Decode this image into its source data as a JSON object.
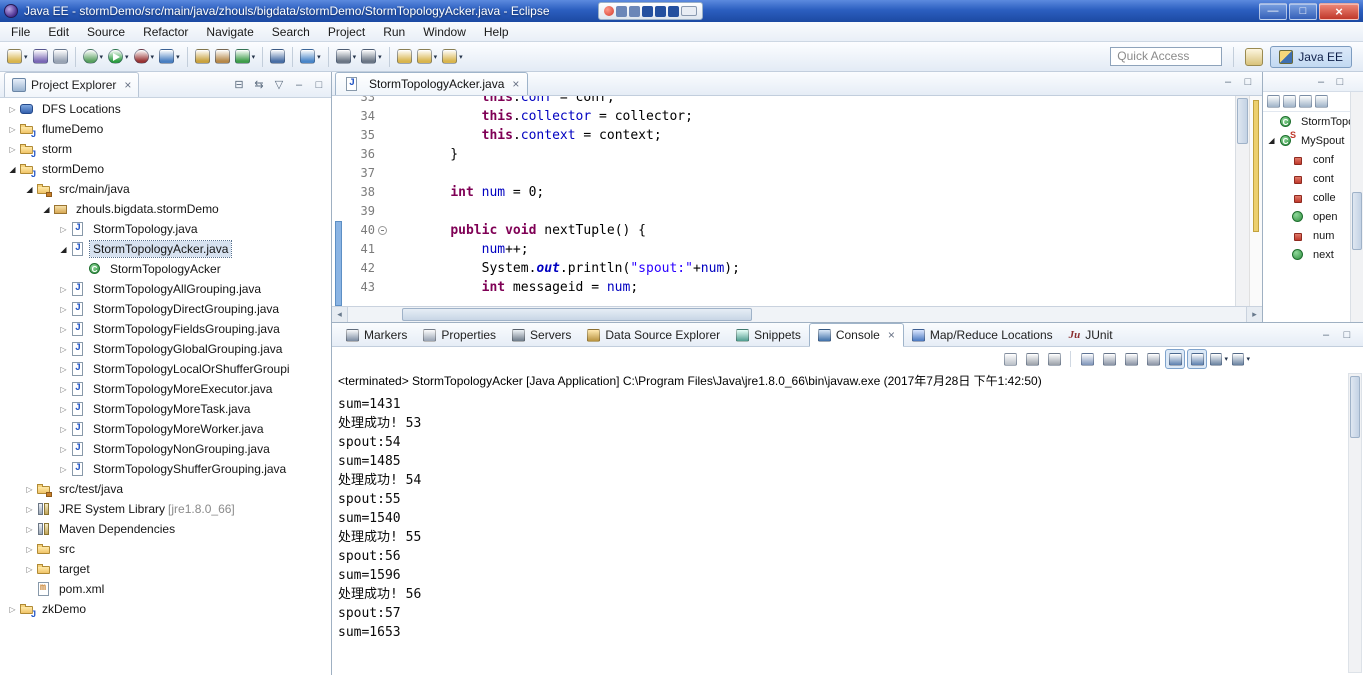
{
  "window": {
    "title": "Java EE - stormDemo/src/main/java/zhouls/bigdata/stormDemo/StormTopologyAcker.java - Eclipse"
  },
  "menubar": [
    "File",
    "Edit",
    "Source",
    "Refactor",
    "Navigate",
    "Search",
    "Project",
    "Run",
    "Window",
    "Help"
  ],
  "toolbar": {
    "quick_access": "Quick Access",
    "perspective_label": "Java EE",
    "icons": [
      {
        "name": "new",
        "color": "#d9b54e",
        "dropdown": true
      },
      {
        "name": "save",
        "color": "#7a68b5"
      },
      {
        "name": "print",
        "color": "#98a3b3"
      },
      {
        "name": "separator"
      },
      {
        "name": "debug",
        "color": "#58a05e",
        "dropdown": true
      },
      {
        "name": "run",
        "color": "#2e9e41",
        "dropdown": true
      },
      {
        "name": "coverage",
        "color": "#993333",
        "dropdown": true
      },
      {
        "name": "run-external",
        "color": "#4a7fc1",
        "dropdown": true
      },
      {
        "name": "separator"
      },
      {
        "name": "new-java-project",
        "color": "#c9a23f"
      },
      {
        "name": "new-package",
        "color": "#b5884a"
      },
      {
        "name": "new-class",
        "color": "#3f9d4b",
        "dropdown": true
      },
      {
        "name": "separator"
      },
      {
        "name": "search",
        "color": "#4a6fa5"
      },
      {
        "name": "separator"
      },
      {
        "name": "external-tools",
        "color": "#4a86c8",
        "dropdown": true
      },
      {
        "name": "separator"
      },
      {
        "name": "next-annotation",
        "color": "#6b7685",
        "dropdown": true
      },
      {
        "name": "previous-annotation",
        "color": "#6b7685",
        "dropdown": true
      },
      {
        "name": "separator"
      },
      {
        "name": "last-edit-location",
        "color": "#d9b54e"
      },
      {
        "name": "back",
        "color": "#d9b54e",
        "dropdown": true
      },
      {
        "name": "forward",
        "color": "#d9b54e",
        "dropdown": true
      }
    ]
  },
  "project_explorer": {
    "title": "Project Explorer",
    "items": [
      {
        "label": "DFS Locations",
        "depth": 0,
        "icon": "dfs",
        "arrow": "collapsed"
      },
      {
        "label": "flumeDemo",
        "depth": 0,
        "icon": "project",
        "arrow": "collapsed"
      },
      {
        "label": "storm",
        "depth": 0,
        "icon": "project",
        "arrow": "collapsed"
      },
      {
        "label": "stormDemo",
        "depth": 0,
        "icon": "project",
        "arrow": "expanded"
      },
      {
        "label": "src/main/java",
        "depth": 1,
        "icon": "srcfolder",
        "arrow": "expanded"
      },
      {
        "label": "zhouls.bigdata.stormDemo",
        "depth": 2,
        "icon": "package",
        "arrow": "expanded"
      },
      {
        "label": "StormTopology.java",
        "depth": 3,
        "icon": "jfile",
        "arrow": "collapsed"
      },
      {
        "label": "StormTopologyAcker.java",
        "depth": 3,
        "icon": "jfile",
        "arrow": "expanded",
        "selected": true
      },
      {
        "label": "StormTopologyAcker",
        "depth": 4,
        "icon": "class",
        "arrow": "none"
      },
      {
        "label": "StormTopologyAllGrouping.java",
        "depth": 3,
        "icon": "jfile",
        "arrow": "collapsed"
      },
      {
        "label": "StormTopologyDirectGrouping.java",
        "depth": 3,
        "icon": "jfile",
        "arrow": "collapsed"
      },
      {
        "label": "StormTopologyFieldsGrouping.java",
        "depth": 3,
        "icon": "jfile",
        "arrow": "collapsed"
      },
      {
        "label": "StormTopologyGlobalGrouping.java",
        "depth": 3,
        "icon": "jfile",
        "arrow": "collapsed"
      },
      {
        "label": "StormTopologyLocalOrShufferGroupi",
        "depth": 3,
        "icon": "jfile",
        "arrow": "collapsed"
      },
      {
        "label": "StormTopologyMoreExecutor.java",
        "depth": 3,
        "icon": "jfile",
        "arrow": "collapsed"
      },
      {
        "label": "StormTopologyMoreTask.java",
        "depth": 3,
        "icon": "jfile",
        "arrow": "collapsed"
      },
      {
        "label": "StormTopologyMoreWorker.java",
        "depth": 3,
        "icon": "jfile",
        "arrow": "collapsed"
      },
      {
        "label": "StormTopologyNonGrouping.java",
        "depth": 3,
        "icon": "jfile",
        "arrow": "collapsed"
      },
      {
        "label": "StormTopologyShufferGrouping.java",
        "depth": 3,
        "icon": "jfile",
        "arrow": "collapsed"
      },
      {
        "label": "src/test/java",
        "depth": 1,
        "icon": "srcfolder",
        "arrow": "collapsed"
      },
      {
        "label": "JRE System Library ",
        "suffix": "[jre1.8.0_66]",
        "depth": 1,
        "icon": "library",
        "arrow": "collapsed"
      },
      {
        "label": "Maven Dependencies",
        "depth": 1,
        "icon": "library",
        "arrow": "collapsed"
      },
      {
        "label": "src",
        "depth": 1,
        "icon": "folder",
        "arrow": "collapsed"
      },
      {
        "label": "target",
        "depth": 1,
        "icon": "folder",
        "arrow": "collapsed"
      },
      {
        "label": "pom.xml",
        "depth": 1,
        "icon": "xmlfile",
        "arrow": "none"
      },
      {
        "label": "zkDemo",
        "depth": 0,
        "icon": "project",
        "arrow": "collapsed"
      }
    ]
  },
  "editor": {
    "tab_label": "StormTopologyAcker.java",
    "lines": [
      {
        "n": 33,
        "fold": false,
        "tokens": [
          {
            "t": "        ",
            "c": "d"
          },
          {
            "t": "this",
            "c": "k"
          },
          {
            "t": ".",
            "c": "d"
          },
          {
            "t": "conf",
            "c": "f"
          },
          {
            "t": " = conf;",
            "c": "d"
          }
        ]
      },
      {
        "n": 34,
        "fold": false,
        "tokens": [
          {
            "t": "        ",
            "c": "d"
          },
          {
            "t": "this",
            "c": "k"
          },
          {
            "t": ".",
            "c": "d"
          },
          {
            "t": "collector",
            "c": "f"
          },
          {
            "t": " = collector;",
            "c": "d"
          }
        ]
      },
      {
        "n": 35,
        "fold": false,
        "tokens": [
          {
            "t": "        ",
            "c": "d"
          },
          {
            "t": "this",
            "c": "k"
          },
          {
            "t": ".",
            "c": "d"
          },
          {
            "t": "context",
            "c": "f"
          },
          {
            "t": " = context;",
            "c": "d"
          }
        ]
      },
      {
        "n": 36,
        "fold": false,
        "tokens": [
          {
            "t": "    }",
            "c": "d"
          }
        ]
      },
      {
        "n": 37,
        "fold": false,
        "tokens": []
      },
      {
        "n": 38,
        "fold": false,
        "tokens": [
          {
            "t": "    ",
            "c": "d"
          },
          {
            "t": "int",
            "c": "k"
          },
          {
            "t": " ",
            "c": "d"
          },
          {
            "t": "num",
            "c": "f"
          },
          {
            "t": " = 0;",
            "c": "d"
          }
        ]
      },
      {
        "n": 39,
        "fold": false,
        "tokens": []
      },
      {
        "n": 40,
        "fold": true,
        "tokens": [
          {
            "t": "    ",
            "c": "d"
          },
          {
            "t": "public",
            "c": "k"
          },
          {
            "t": " ",
            "c": "d"
          },
          {
            "t": "void",
            "c": "k"
          },
          {
            "t": " nextTuple() {",
            "c": "d"
          }
        ]
      },
      {
        "n": 41,
        "fold": false,
        "tokens": [
          {
            "t": "        ",
            "c": "d"
          },
          {
            "t": "num",
            "c": "f"
          },
          {
            "t": "++;",
            "c": "d"
          }
        ]
      },
      {
        "n": 42,
        "fold": false,
        "tokens": [
          {
            "t": "        System.",
            "c": "d"
          },
          {
            "t": "out",
            "c": "sf"
          },
          {
            "t": ".println(",
            "c": "d"
          },
          {
            "t": "\"spout:\"",
            "c": "s"
          },
          {
            "t": "+",
            "c": "d"
          },
          {
            "t": "num",
            "c": "f"
          },
          {
            "t": ");",
            "c": "d"
          }
        ]
      },
      {
        "n": 43,
        "fold": false,
        "tokens": [
          {
            "t": "        ",
            "c": "d"
          },
          {
            "t": "int",
            "c": "k"
          },
          {
            "t": " messageid = ",
            "c": "d"
          },
          {
            "t": "num",
            "c": "f"
          },
          {
            "t": ";",
            "c": "d"
          }
        ]
      }
    ]
  },
  "outline": {
    "items": [
      {
        "label": "StormTopolo",
        "depth": 0,
        "icon": "class",
        "arrow": "none"
      },
      {
        "label": "MySpout",
        "depth": 0,
        "icon": "class-s",
        "arrow": "expanded"
      },
      {
        "label": "conf",
        "depth": 1,
        "icon": "field",
        "arrow": "none"
      },
      {
        "label": "cont",
        "depth": 1,
        "icon": "field",
        "arrow": "none"
      },
      {
        "label": "colle",
        "depth": 1,
        "icon": "field",
        "arrow": "none"
      },
      {
        "label": "open",
        "depth": 1,
        "icon": "method",
        "arrow": "none"
      },
      {
        "label": "num",
        "depth": 1,
        "icon": "field",
        "ar row": "none",
        "arrow": "none"
      },
      {
        "label": "next",
        "depth": 1,
        "icon": "method",
        "arrow": "none"
      }
    ]
  },
  "console": {
    "tabs": [
      {
        "label": "Markers",
        "icon": "markers"
      },
      {
        "label": "Properties",
        "icon": "properties"
      },
      {
        "label": "Servers",
        "icon": "servers"
      },
      {
        "label": "Data Source Explorer",
        "icon": "datasource"
      },
      {
        "label": "Snippets",
        "icon": "snippets"
      },
      {
        "label": "Console",
        "icon": "console",
        "active": true
      },
      {
        "label": "Map/Reduce Locations",
        "icon": "mapreduce"
      },
      {
        "label": "JUnit",
        "icon": "junit",
        "icon_glyph": "Ju"
      }
    ],
    "toolbar_icons": [
      {
        "name": "terminate",
        "color": "#b9bfc7"
      },
      {
        "name": "remove-launch",
        "color": "#9aa0a8"
      },
      {
        "name": "remove-all-terminated",
        "color": "#9aa0a8"
      },
      {
        "name": "separator"
      },
      {
        "name": "clear-console",
        "color": "#7d93b8"
      },
      {
        "name": "scroll-lock",
        "color": "#8a94a5"
      },
      {
        "name": "word-wrap",
        "color": "#8a94a5"
      },
      {
        "name": "pin-console",
        "color": "#8a94a5"
      },
      {
        "name": "show-on-stdout",
        "color": "#5b7fae",
        "pressed": true
      },
      {
        "name": "show-on-stderr",
        "color": "#5b7fae",
        "pressed": true
      },
      {
        "name": "display-selected-console",
        "color": "#67809f",
        "dropdown": true
      },
      {
        "name": "open-console",
        "color": "#67809f",
        "dropdown": true
      }
    ],
    "status": "<terminated> StormTopologyAcker [Java Application] C:\\Program Files\\Java\\jre1.8.0_66\\bin\\javaw.exe (2017年7月28日 下午1:42:50)",
    "output": [
      "sum=1431",
      "处理成功! 53",
      "spout:54",
      "sum=1485",
      "处理成功! 54",
      "spout:55",
      "sum=1540",
      "处理成功! 55",
      "spout:56",
      "sum=1596",
      "处理成功! 56",
      "spout:57",
      "sum=1653"
    ]
  }
}
